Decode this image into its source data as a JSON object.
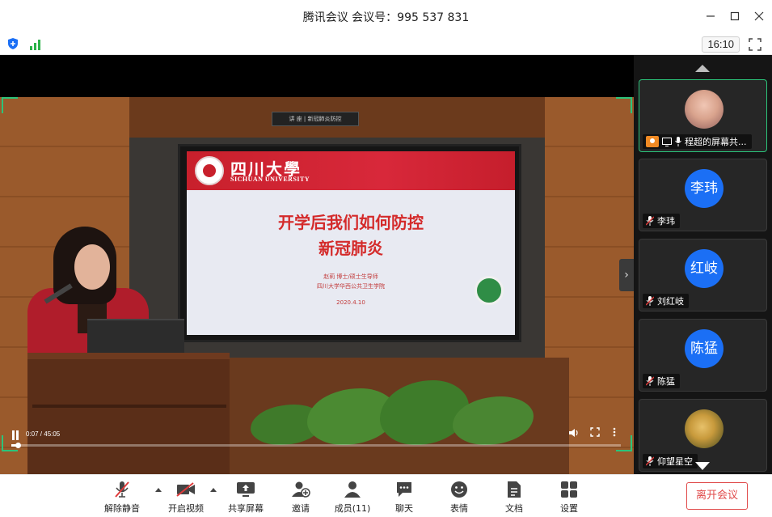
{
  "window": {
    "title": "腾讯会议 会议号：995 537 831",
    "controls": [
      "minimize-icon",
      "maximize-icon",
      "close-icon"
    ]
  },
  "status": {
    "clock": "16:10",
    "icons": [
      "shield-icon",
      "signal-icon",
      "fullscreen-icon"
    ]
  },
  "shared_screen": {
    "caption": "讲 座 | 新冠肺炎防控",
    "slide": {
      "university_cn": "四川大學",
      "university_en": "SICHUAN UNIVERSITY",
      "title_line1": "开学后我们如何防控",
      "title_line2": "新冠肺炎",
      "author": "赵莉 博士/硕士生导师",
      "institution": "四川大学华西公共卫生学院",
      "date": "2020.4.10"
    },
    "player": {
      "time": "0:07 / 45:05",
      "progress": 0.01,
      "controls": [
        "pause-icon",
        "volume-icon",
        "expand-icon",
        "more-icon"
      ]
    },
    "accent_color": "#2cc37a"
  },
  "participants": [
    {
      "name": "程超的屏幕共...",
      "avatar_text": "",
      "avatar_kind": "photo",
      "muted": false,
      "sharing": true,
      "active": true
    },
    {
      "name": "李玮",
      "avatar_text": "李玮",
      "avatar_kind": "initials",
      "muted": true,
      "sharing": false,
      "active": false
    },
    {
      "name": "刘红岐",
      "avatar_text": "红岐",
      "avatar_kind": "initials",
      "muted": true,
      "sharing": false,
      "active": false
    },
    {
      "name": "陈猛",
      "avatar_text": "陈猛",
      "avatar_kind": "initials",
      "muted": true,
      "sharing": false,
      "active": false
    },
    {
      "name": "仰望星空",
      "avatar_text": "",
      "avatar_kind": "photo",
      "muted": true,
      "sharing": false,
      "active": false
    }
  ],
  "toolbar": {
    "unmute": "解除静音",
    "start_video": "开启视频",
    "share_screen": "共享屏幕",
    "invite": "邀请",
    "members": "成员(11)",
    "chat": "聊天",
    "reactions": "表情",
    "docs": "文档",
    "settings": "设置",
    "leave": "离开会议"
  },
  "colors": {
    "avatar_blue": "#1b6ff5",
    "leave_red": "#e04a4a",
    "muted_red": "#e03b3b"
  }
}
